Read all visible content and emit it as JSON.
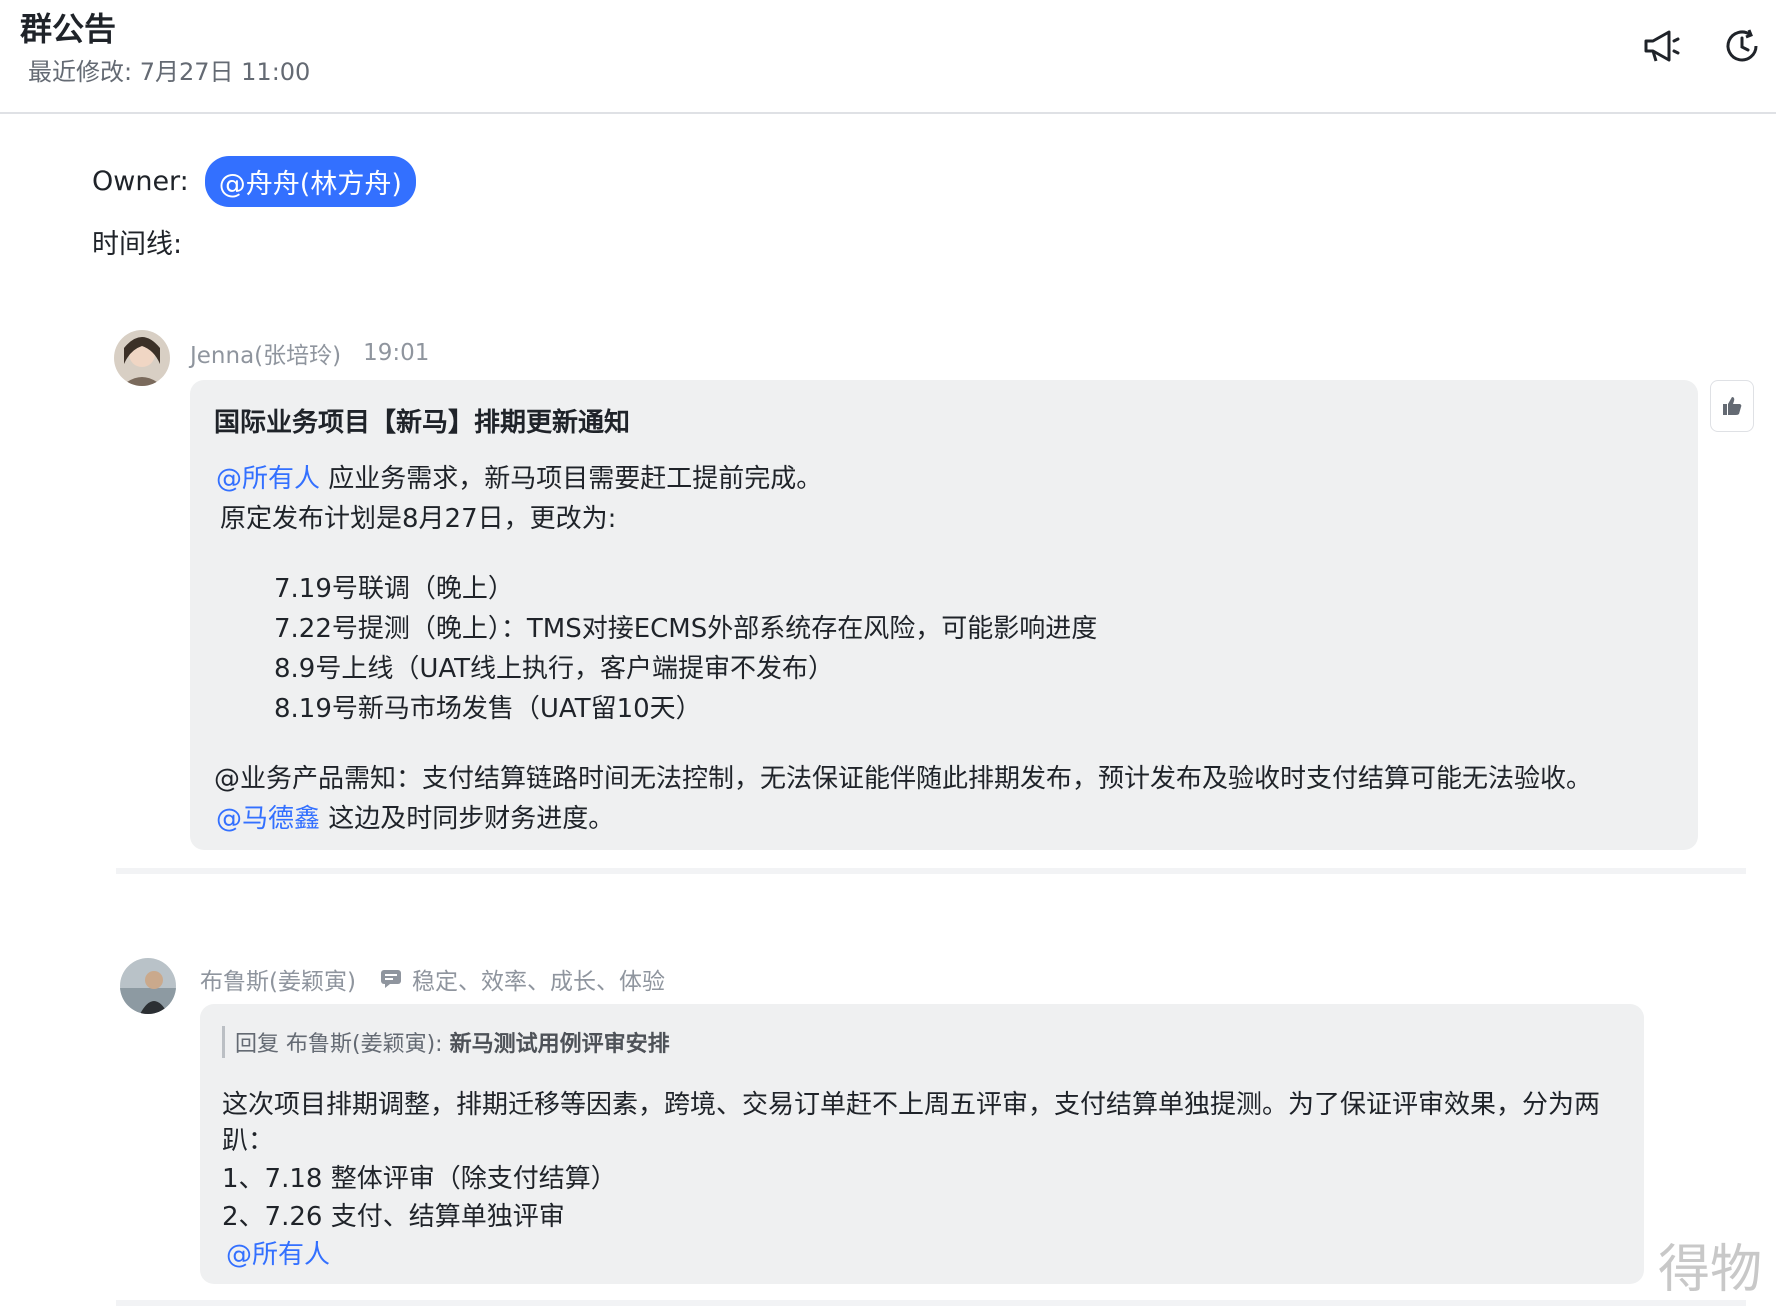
{
  "header": {
    "title": "群公告",
    "subtitle": "最近修改: 7月27日 11:00",
    "icons": [
      "megaphone-icon",
      "history-icon"
    ]
  },
  "announcement": {
    "owner_label": "Owner:",
    "owner_mention": "@舟舟(林方舟)",
    "timeline_label": "时间线:"
  },
  "messages": [
    {
      "sender": "Jenna(张培玲)",
      "time": "19:01",
      "title": "国际业务项目【新马】排期更新通知",
      "mention_all": "@所有人",
      "line1": " 应业务需求，新马项目需要赶工提前完成。",
      "line2": "原定发布计划是8月27日，更改为:",
      "schedule": [
        "7.19号联调（晚上）",
        "7.22号提测（晚上）：TMS对接ECMS外部系统存在风险，可能影响进度",
        "8.9号上线（UAT线上执行，客户端提审不发布）",
        "8.19号新马市场发售（UAT留10天）"
      ],
      "note": "@业务产品需知：支付结算链路时间无法控制，无法保证能伴随此排期发布，预计发布及验收时支付结算可能无法验收。",
      "mention_person": "@马德鑫",
      "note_tail": " 这边及时同步财务进度。"
    },
    {
      "sender": "布鲁斯(姜颖寅)",
      "status": "稳定、效率、成长、体验",
      "reply_prefix": "回复 布鲁斯(姜颖寅):",
      "reply_subject": "新马测试用例评审安排",
      "body_line1": "这次项目排期调整，排期迁移等因素，跨境、交易订单赶不上周五评审，支付结算单独提测。为了保证评审效果，分为两",
      "body_line2": "趴：",
      "items": [
        "1、7.18 整体评审（除支付结算）",
        "2、7.26 支付、结算单独评审"
      ],
      "mention_all": "@所有人"
    }
  ],
  "logo_text": "得物"
}
